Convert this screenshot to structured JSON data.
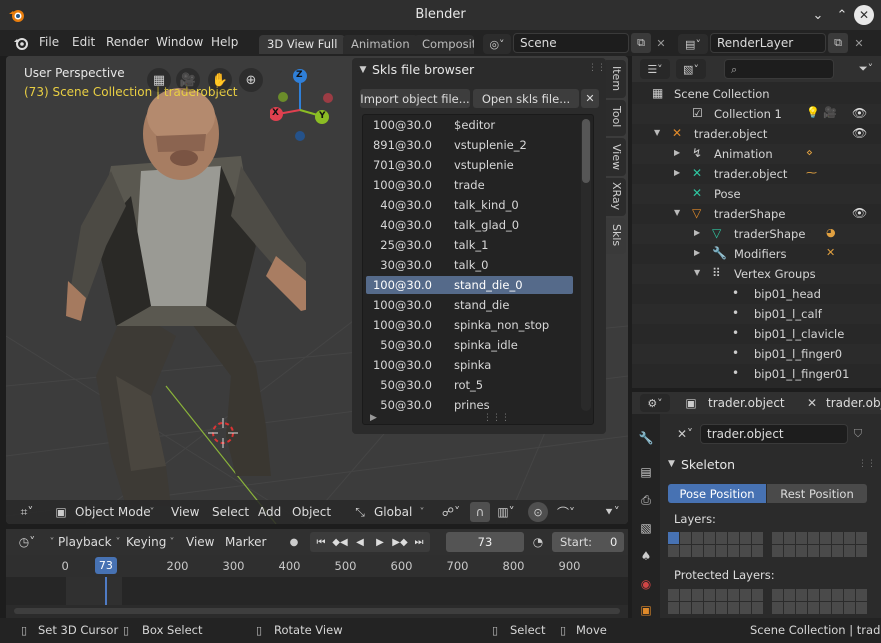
{
  "window": {
    "title": "Blender"
  },
  "menubar": {
    "items": [
      "File",
      "Edit",
      "Render",
      "Window",
      "Help"
    ],
    "workspace_tabs": [
      "3D View Full",
      "Animation",
      "Compositi"
    ],
    "scene": "Scene",
    "render_layer": "RenderLayer"
  },
  "viewport": {
    "perspective": "User Perspective",
    "collection_info": "(73) Scene Collection | traderobject",
    "gizmo": {
      "x": "X",
      "y": "Y",
      "z": "Z"
    },
    "header": {
      "mode": "Object Mode",
      "menus": [
        "View",
        "Select",
        "Add",
        "Object"
      ],
      "orientation": "Global"
    }
  },
  "skls": {
    "title": "Skls file browser",
    "import_btn": "Import object file...",
    "open_btn": "Open skls file...",
    "rows": [
      {
        "fps": "100@30.0",
        "name": "$editor"
      },
      {
        "fps": "891@30.0",
        "name": "vstuplenie_2"
      },
      {
        "fps": "701@30.0",
        "name": "vstuplenie"
      },
      {
        "fps": "100@30.0",
        "name": "trade"
      },
      {
        "fps": "40@30.0",
        "name": "talk_kind_0"
      },
      {
        "fps": "40@30.0",
        "name": "talk_glad_0"
      },
      {
        "fps": "25@30.0",
        "name": "talk_1"
      },
      {
        "fps": "30@30.0",
        "name": "talk_0"
      },
      {
        "fps": "100@30.0",
        "name": "stand_die_0"
      },
      {
        "fps": "100@30.0",
        "name": "stand_die"
      },
      {
        "fps": "100@30.0",
        "name": "spinka_non_stop"
      },
      {
        "fps": "50@30.0",
        "name": "spinka_idle"
      },
      {
        "fps": "100@30.0",
        "name": "spinka"
      },
      {
        "fps": "50@30.0",
        "name": "rot_5"
      },
      {
        "fps": "50@30.0",
        "name": "prines"
      }
    ],
    "selected_index": 8,
    "side_tabs": [
      "Item",
      "Tool",
      "View",
      "XRay",
      "Skls"
    ]
  },
  "outliner": {
    "rows": [
      "Scene Collection",
      "Collection 1",
      "trader.object",
      "Animation",
      "trader.object",
      "Pose",
      "traderShape",
      "traderShape",
      "Modifiers",
      "Vertex Groups",
      "bip01_head",
      "bip01_l_calf",
      "bip01_l_clavicle",
      "bip01_l_finger0",
      "bip01_l_finger01"
    ]
  },
  "properties": {
    "object_tab": "trader.object",
    "object_tab2": "trader.obj",
    "armature_name": "trader.object",
    "section": "Skeleton",
    "pose_position": "Pose Position",
    "rest_position": "Rest Position",
    "layers_label": "Layers:",
    "protected_layers_label": "Protected Layers:"
  },
  "timeline": {
    "menus": [
      "Playback",
      "Keying",
      "View",
      "Marker"
    ],
    "current_frame": "73",
    "start_label": "Start:",
    "start_value": "0",
    "ruler": [
      "0",
      "73",
      "200",
      "300",
      "400",
      "500",
      "600",
      "700",
      "800",
      "900"
    ],
    "playhead": 73
  },
  "statusbar": {
    "set_cursor": "Set 3D Cursor",
    "box_select": "Box Select",
    "rotate_view": "Rotate View",
    "select": "Select",
    "move": "Move",
    "info": "Scene Collection | trader.o"
  }
}
